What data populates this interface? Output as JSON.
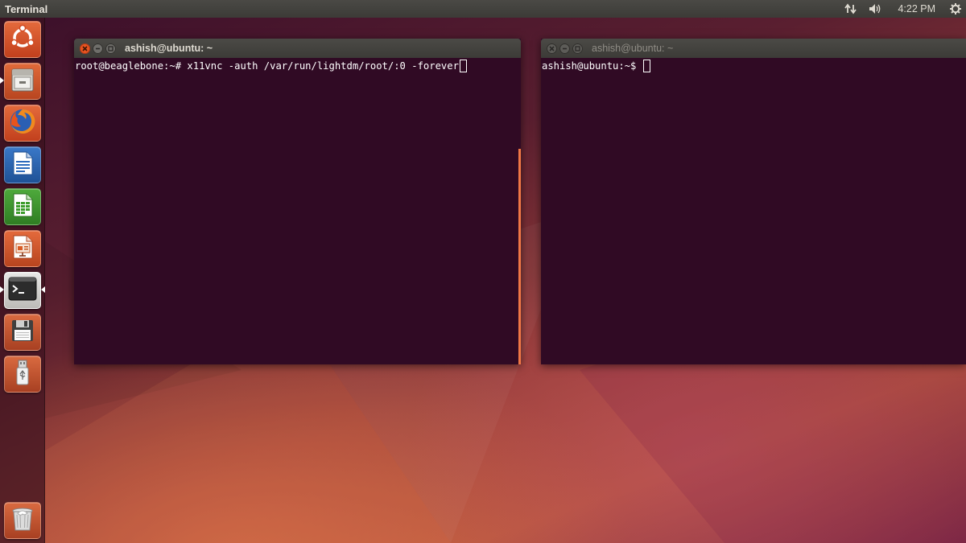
{
  "top_panel": {
    "app_name": "Terminal",
    "clock": "4:22 PM",
    "icons": [
      "network-icon",
      "volume-icon",
      "settings-gear-icon"
    ]
  },
  "launcher": {
    "items": [
      {
        "name": "dash-home",
        "icon": "ubuntu-logo-icon"
      },
      {
        "name": "files",
        "icon": "file-cabinet-icon"
      },
      {
        "name": "firefox",
        "icon": "firefox-icon"
      },
      {
        "name": "libreoffice-writer",
        "icon": "writer-document-icon"
      },
      {
        "name": "libreoffice-calc",
        "icon": "calc-spreadsheet-icon"
      },
      {
        "name": "libreoffice-impress",
        "icon": "impress-presentation-icon"
      },
      {
        "name": "terminal",
        "icon": "terminal-icon"
      },
      {
        "name": "floppy-drive",
        "icon": "floppy-disk-icon"
      },
      {
        "name": "usb-drive",
        "icon": "usb-drive-icon"
      },
      {
        "name": "trash",
        "icon": "trash-icon"
      }
    ]
  },
  "terminals": [
    {
      "title": "ashish@ubuntu: ~",
      "lines": [
        "root@beaglebone:~# x11vnc -auth /var/run/lightdm/root/:0 -forever"
      ],
      "focused": true
    },
    {
      "title": "ashish@ubuntu: ~",
      "lines": [
        "ashish@ubuntu:~$ "
      ],
      "focused": false
    }
  ],
  "colors": {
    "terminal_bg": "#300a24",
    "panel_bg": "#3c3b37",
    "close_button": "#e95420",
    "scrollbar_accent": "#f07746"
  }
}
